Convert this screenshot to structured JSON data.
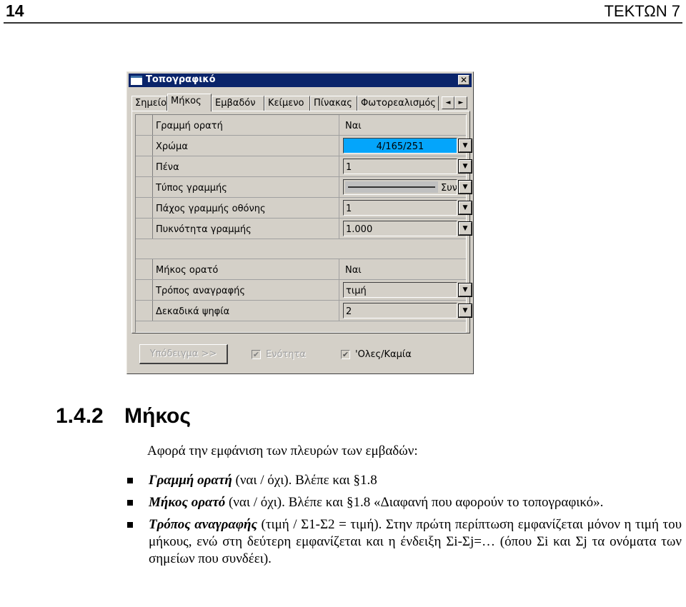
{
  "page_header": {
    "page_number": "14",
    "running_title": "ΤΕΚΤΩΝ 7"
  },
  "dialog": {
    "title": "Τοπογραφικό",
    "close_label": "✕",
    "tabs": [
      {
        "label": "Σημείο",
        "active": false
      },
      {
        "label": "Μήκος",
        "active": true
      },
      {
        "label": "Εμβαδόν",
        "active": false
      },
      {
        "label": "Κείμενο",
        "active": false
      },
      {
        "label": "Πίνακας",
        "active": false
      },
      {
        "label": "Φωτορεαλισμός",
        "active": false
      }
    ],
    "tab_scroll_left": "◄",
    "tab_scroll_right": "►",
    "properties": [
      {
        "label": "Γραμμή ορατή",
        "value": "Ναι",
        "type": "text"
      },
      {
        "label": "Χρώμα",
        "value": "4/165/251",
        "type": "color",
        "color": "#04a5fb"
      },
      {
        "label": "Πένα",
        "value": "1",
        "type": "dropdown"
      },
      {
        "label": "Τύπος γραμμής",
        "value": "Συν",
        "type": "linetype"
      },
      {
        "label": "Πάχος γραμμής οθόνης",
        "value": "1",
        "type": "dropdown"
      },
      {
        "label": "Πυκνότητα γραμμής",
        "value": "1.000",
        "type": "dropdown"
      },
      {
        "label": "Μήκος ορατό",
        "value": "Ναι",
        "type": "text"
      },
      {
        "label": "Τρόπος αναγραφής",
        "value": "τιμή",
        "type": "dropdown"
      },
      {
        "label": "Δεκαδικά ψηφία",
        "value": "2",
        "type": "dropdown"
      }
    ],
    "dropdown_arrow": "▼",
    "template_button": "Υπόδειγμα >>",
    "checkbox_unit": {
      "label": "Ενότητα",
      "checked": true,
      "enabled": false
    },
    "checkbox_all": {
      "label": "'Ολες/Καμία",
      "checked": true,
      "enabled": true
    },
    "check_mark": "✔"
  },
  "section": {
    "number": "1.4.2",
    "title": "Μήκος",
    "intro": "Αφορά την εμφάνιση των πλευρών των εμβαδών:",
    "bullets": [
      {
        "term": "Γραμμή ορατή",
        "text": " (ναι / όχι). Βλέπε και §1.8"
      },
      {
        "term": "Μήκος ορατό",
        "text": " (ναι / όχι). Βλέπε και §1.8 «Διαφανή που αφορούν το τοπογραφικό»."
      },
      {
        "term": "Τρόπος αναγραφής",
        "text": " (τιμή / Σ1-Σ2 = τιμή). Στην πρώτη περίπτωση εμφανίζεται μόνον η τιμή του μήκους, ενώ στη δεύτερη εμφανίζεται και η ένδειξη Σi-Σj=… (όπου Σi και Σj τα ονόματα των σημείων που συνδέει)."
      }
    ]
  }
}
